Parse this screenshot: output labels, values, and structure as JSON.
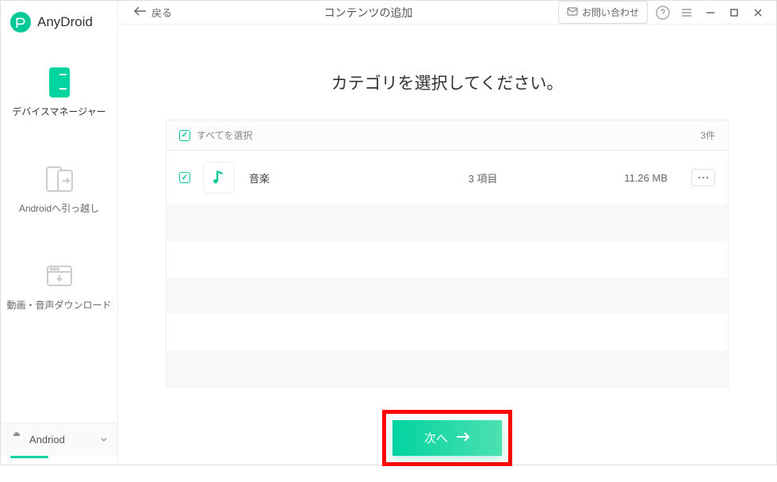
{
  "app": {
    "name": "AnyDroid"
  },
  "sidebar": {
    "items": [
      {
        "label": "デバイスマネージャー"
      },
      {
        "label": "Androidへ引っ越し"
      },
      {
        "label": "動画・音声ダウンロード"
      }
    ]
  },
  "device": {
    "name": "Andriod"
  },
  "topbar": {
    "back": "戻る",
    "title": "コンテンツの追加",
    "contact": "お問い合わせ"
  },
  "content": {
    "heading": "カテゴリを選択してください。",
    "select_all": "すべてを選択",
    "count": "3件",
    "rows": [
      {
        "name": "音楽",
        "items": "3 項目",
        "size": "11.26 MB"
      }
    ],
    "next": "次へ"
  }
}
